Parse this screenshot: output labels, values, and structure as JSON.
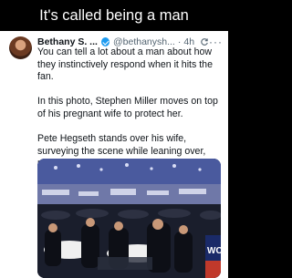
{
  "caption": "It's called being a man",
  "tweet": {
    "name": "Bethany S. ...",
    "handle": "@bethanysh...",
    "separator": "·",
    "time": "4h",
    "more": "···",
    "paragraphs": [
      "You can tell a lot about a man about how they instinctively respond when it hits the fan.",
      "In this photo, Stephen Miller moves on top of his pregnant wife to protect her.",
      "Pete Hegseth stands over his wife, surveying the scene while leaning over,  protecting her."
    ],
    "photo_badge": "WC"
  },
  "colors": {
    "verified": "#1d9bf0",
    "text": "#0f1419",
    "secondary": "#536471"
  },
  "icons": [
    "verified-icon",
    "refresh-icon",
    "more-options-icon"
  ]
}
